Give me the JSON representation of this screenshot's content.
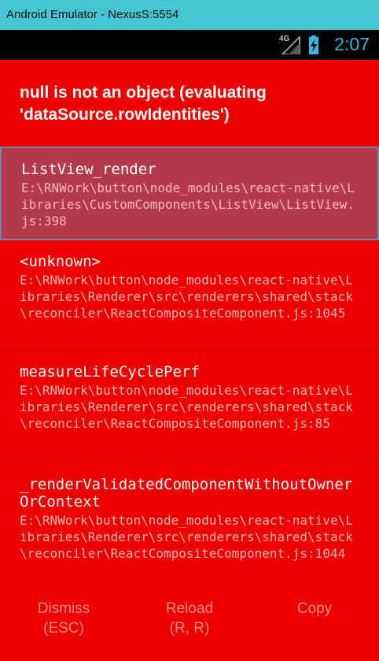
{
  "window": {
    "title": "Android Emulator - NexusS:5554"
  },
  "status_bar": {
    "network": "4G",
    "time": "2:07"
  },
  "error": {
    "message": "null is not an object (evaluating 'dataSource.rowIdentities')"
  },
  "stack_frames": [
    {
      "function": "ListView_render",
      "location": "E:\\RNWork\\button\\node_modules\\react-native\\Libraries\\CustomComponents\\ListView\\ListView.js:398",
      "selected": true
    },
    {
      "function": "<unknown>",
      "location": "E:\\RNWork\\button\\node_modules\\react-native\\Libraries\\Renderer\\src\\renderers\\shared\\stack\\reconciler\\ReactCompositeComponent.js:1045",
      "selected": false
    },
    {
      "function": "measureLifeCyclePerf",
      "location": "E:\\RNWork\\button\\node_modules\\react-native\\Libraries\\Renderer\\src\\renderers\\shared\\stack\\reconciler\\ReactCompositeComponent.js:85",
      "selected": false
    },
    {
      "function": "_renderValidatedComponentWithoutOwnerOrContext",
      "location": "E:\\RNWork\\button\\node_modules\\react-native\\Libraries\\Renderer\\src\\renderers\\shared\\stack\\reconciler\\ReactCompositeComponent.js:1044",
      "selected": false
    }
  ],
  "actions": {
    "dismiss": {
      "label": "Dismiss",
      "shortcut": "(ESC)"
    },
    "reload": {
      "label": "Reload",
      "shortcut": "(R, R)"
    },
    "copy": {
      "label": "Copy"
    }
  },
  "colors": {
    "background": "#ee0000",
    "titlebar": "#45c6d2",
    "selected_frame": "#b23a4a",
    "clock": "#33b5e5",
    "action_text": "#fb8b8b"
  }
}
